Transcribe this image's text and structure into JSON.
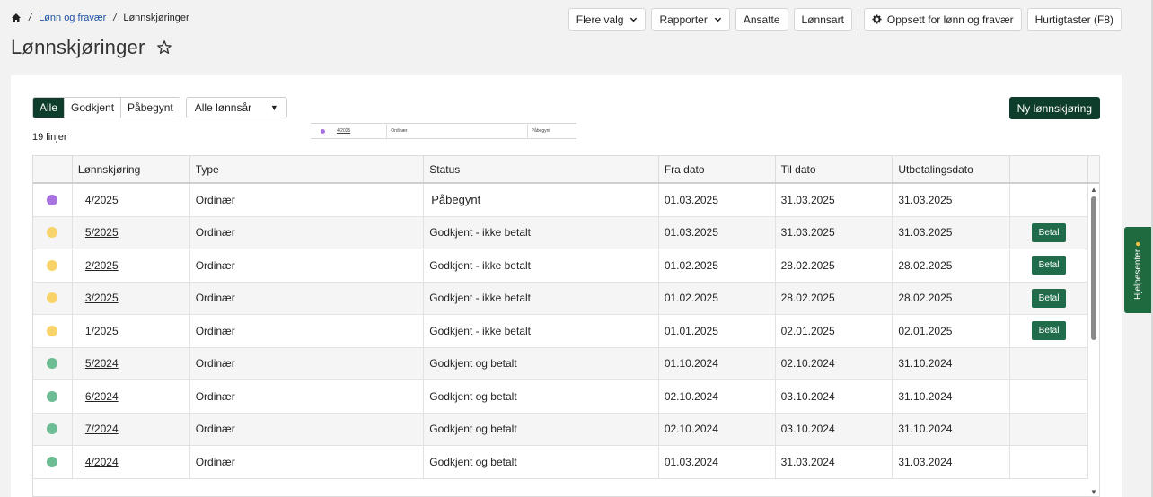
{
  "breadcrumb": {
    "link": "Lønn og fravær",
    "current": "Lønnskjøringer"
  },
  "page_title": "Lønnskjøringer",
  "toolbar": {
    "flere_valg": "Flere valg",
    "rapporter": "Rapporter",
    "ansatte": "Ansatte",
    "lonnsart": "Lønnsart",
    "oppsett": "Oppsett for lønn og fravær",
    "hurtigtaster": "Hurtigtaster (F8)"
  },
  "filters": {
    "tabs": [
      "Alle",
      "Godkjent",
      "Påbegynt"
    ],
    "active_tab": "Alle",
    "year_select": "Alle lønnsår"
  },
  "line_count": "19 linjer",
  "new_button": "Ny lønnskjøring",
  "thumb": {
    "id": "4/2025",
    "type": "Ordinær",
    "status": "Påbegynt"
  },
  "columns": [
    "Lønnskjøring",
    "Type",
    "Status",
    "Fra dato",
    "Til dato",
    "Utbetalingsdato"
  ],
  "rows": [
    {
      "id": "4/2025",
      "type": "Ordinær",
      "status": "Påbegynt",
      "from": "01.03.2025",
      "to": "31.03.2025",
      "pay": "31.03.2025",
      "dot": "#a872e0",
      "action": ""
    },
    {
      "id": "5/2025",
      "type": "Ordinær",
      "status": "Godkjent - ikke betalt",
      "from": "01.03.2025",
      "to": "31.03.2025",
      "pay": "31.03.2025",
      "dot": "#f8d36a",
      "action": "Betal"
    },
    {
      "id": "2/2025",
      "type": "Ordinær",
      "status": "Godkjent - ikke betalt",
      "from": "01.02.2025",
      "to": "28.02.2025",
      "pay": "28.02.2025",
      "dot": "#f8d36a",
      "action": "Betal"
    },
    {
      "id": "3/2025",
      "type": "Ordinær",
      "status": "Godkjent - ikke betalt",
      "from": "01.02.2025",
      "to": "28.02.2025",
      "pay": "28.02.2025",
      "dot": "#f8d36a",
      "action": "Betal"
    },
    {
      "id": "1/2025",
      "type": "Ordinær",
      "status": "Godkjent - ikke betalt",
      "from": "01.01.2025",
      "to": "02.01.2025",
      "pay": "02.01.2025",
      "dot": "#f8d36a",
      "action": "Betal"
    },
    {
      "id": "5/2024",
      "type": "Ordinær",
      "status": "Godkjent og betalt",
      "from": "01.10.2024",
      "to": "02.10.2024",
      "pay": "31.10.2024",
      "dot": "#6cbd94",
      "action": ""
    },
    {
      "id": "6/2024",
      "type": "Ordinær",
      "status": "Godkjent og betalt",
      "from": "02.10.2024",
      "to": "03.10.2024",
      "pay": "31.10.2024",
      "dot": "#6cbd94",
      "action": ""
    },
    {
      "id": "7/2024",
      "type": "Ordinær",
      "status": "Godkjent og betalt",
      "from": "02.10.2024",
      "to": "03.10.2024",
      "pay": "31.10.2024",
      "dot": "#6cbd94",
      "action": ""
    },
    {
      "id": "4/2024",
      "type": "Ordinær",
      "status": "Godkjent og betalt",
      "from": "01.03.2024",
      "to": "31.03.2024",
      "pay": "31.03.2024",
      "dot": "#6cbd94",
      "action": ""
    }
  ],
  "help_tab": "Hjelpesenter"
}
